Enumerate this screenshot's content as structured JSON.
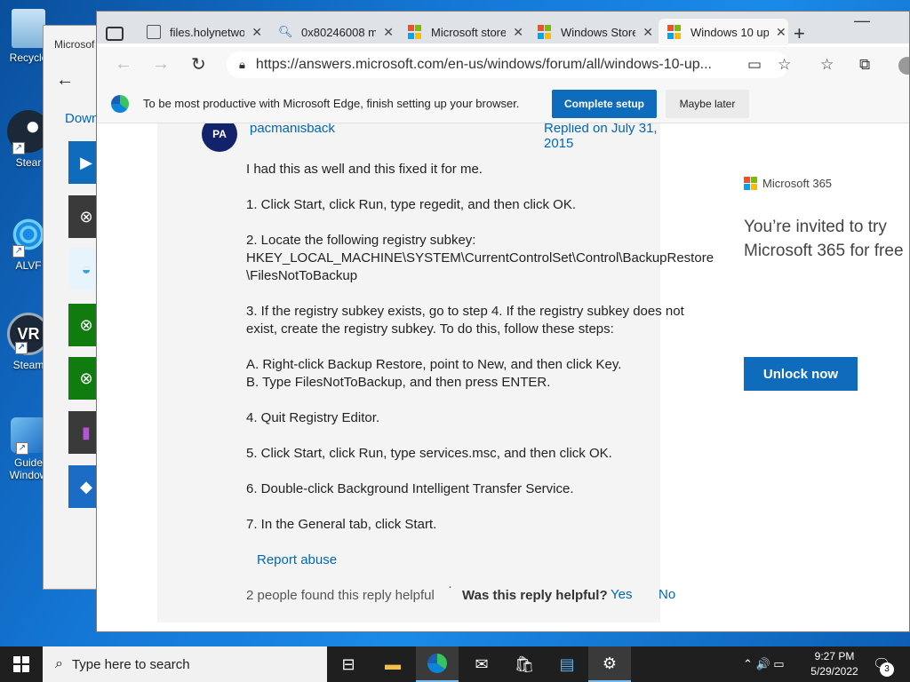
{
  "desktop": {
    "icons": [
      {
        "label": "Recycle",
        "icon": "recycle-bin-icon"
      },
      {
        "label": "Stear",
        "icon": "steam-icon"
      },
      {
        "label": "ALVF",
        "icon": "alvr-icon"
      },
      {
        "label": "Steam",
        "icon": "steamvr-icon"
      },
      {
        "label": "Guide",
        "label2": "Window",
        "icon": "windows-guide-icon"
      }
    ]
  },
  "store_window": {
    "title": "Microsof",
    "back_icon": "back-arrow-icon",
    "downloads_label": "Down"
  },
  "browser": {
    "tabs": [
      {
        "title": "files.holynetwo",
        "icon": "file-icon"
      },
      {
        "title": "0x80246008 m",
        "icon": "search-icon"
      },
      {
        "title": "Microsoft store",
        "icon": "microsoft-logo-icon"
      },
      {
        "title": "Windows Store",
        "icon": "microsoft-logo-icon"
      },
      {
        "title": "Windows 10 up",
        "icon": "microsoft-logo-icon"
      }
    ],
    "new_tab_glyph": "+",
    "minimize_glyph": "—",
    "url": "https://answers.microsoft.com/en-us/windows/forum/all/windows-10-up...",
    "infobar": {
      "text": "To be most productive with Microsoft Edge, finish setting up your browser.",
      "complete_label": "Complete setup",
      "later_label": "Maybe later"
    }
  },
  "reply": {
    "avatar": "PA",
    "username": "pacmanisback",
    "replied": "Replied on July 31, 2015",
    "paragraphs": [
      "I had this as well and this fixed it for me.",
      "1. Click Start, click Run, type regedit, and then click OK.",
      "2. Locate the following registry subkey:\nHKEY_LOCAL_MACHINE\\SYSTEM\\CurrentControlSet\\Control\\BackupRestore\n\\FilesNotToBackup",
      "3. If the registry subkey exists, go to step 4. If the registry subkey does not exist, create the registry subkey. To do this, follow these steps:",
      "A. Right-click Backup Restore, point to New, and then click Key.\nB. Type FilesNotToBackup, and then press ENTER.",
      "4. Quit Registry Editor.",
      "5. Click Start, click Run, type services.msc, and then click OK.",
      "6. Double-click Background Intelligent Transfer Service.",
      "7. In the General tab, click Start."
    ],
    "report": "Report abuse",
    "helpful_count": "2 people found this reply helpful",
    "helpful_separator": "·",
    "helpful_question": "Was this reply helpful?",
    "yes": "Yes",
    "no": "No"
  },
  "ad": {
    "brand": "Microsoft 365",
    "headline_line1": "You’re invited to try",
    "headline_line2": "Microsoft 365 for free",
    "button": "Unlock now"
  },
  "taskbar": {
    "search_placeholder": "Type here to search",
    "time": "9:27 PM",
    "date": "5/29/2022",
    "notification_count": "3",
    "tray_glyphs": "⌃ 🔊 ▭"
  },
  "colors": {
    "accent": "#0f6cbd",
    "link": "#0067b8",
    "avatar": "#13236b",
    "taskbar": "#1f1f1f",
    "ms_red": "#f25022",
    "ms_green": "#7fba00",
    "ms_blue": "#00a4ef",
    "ms_yellow": "#ffb900"
  }
}
